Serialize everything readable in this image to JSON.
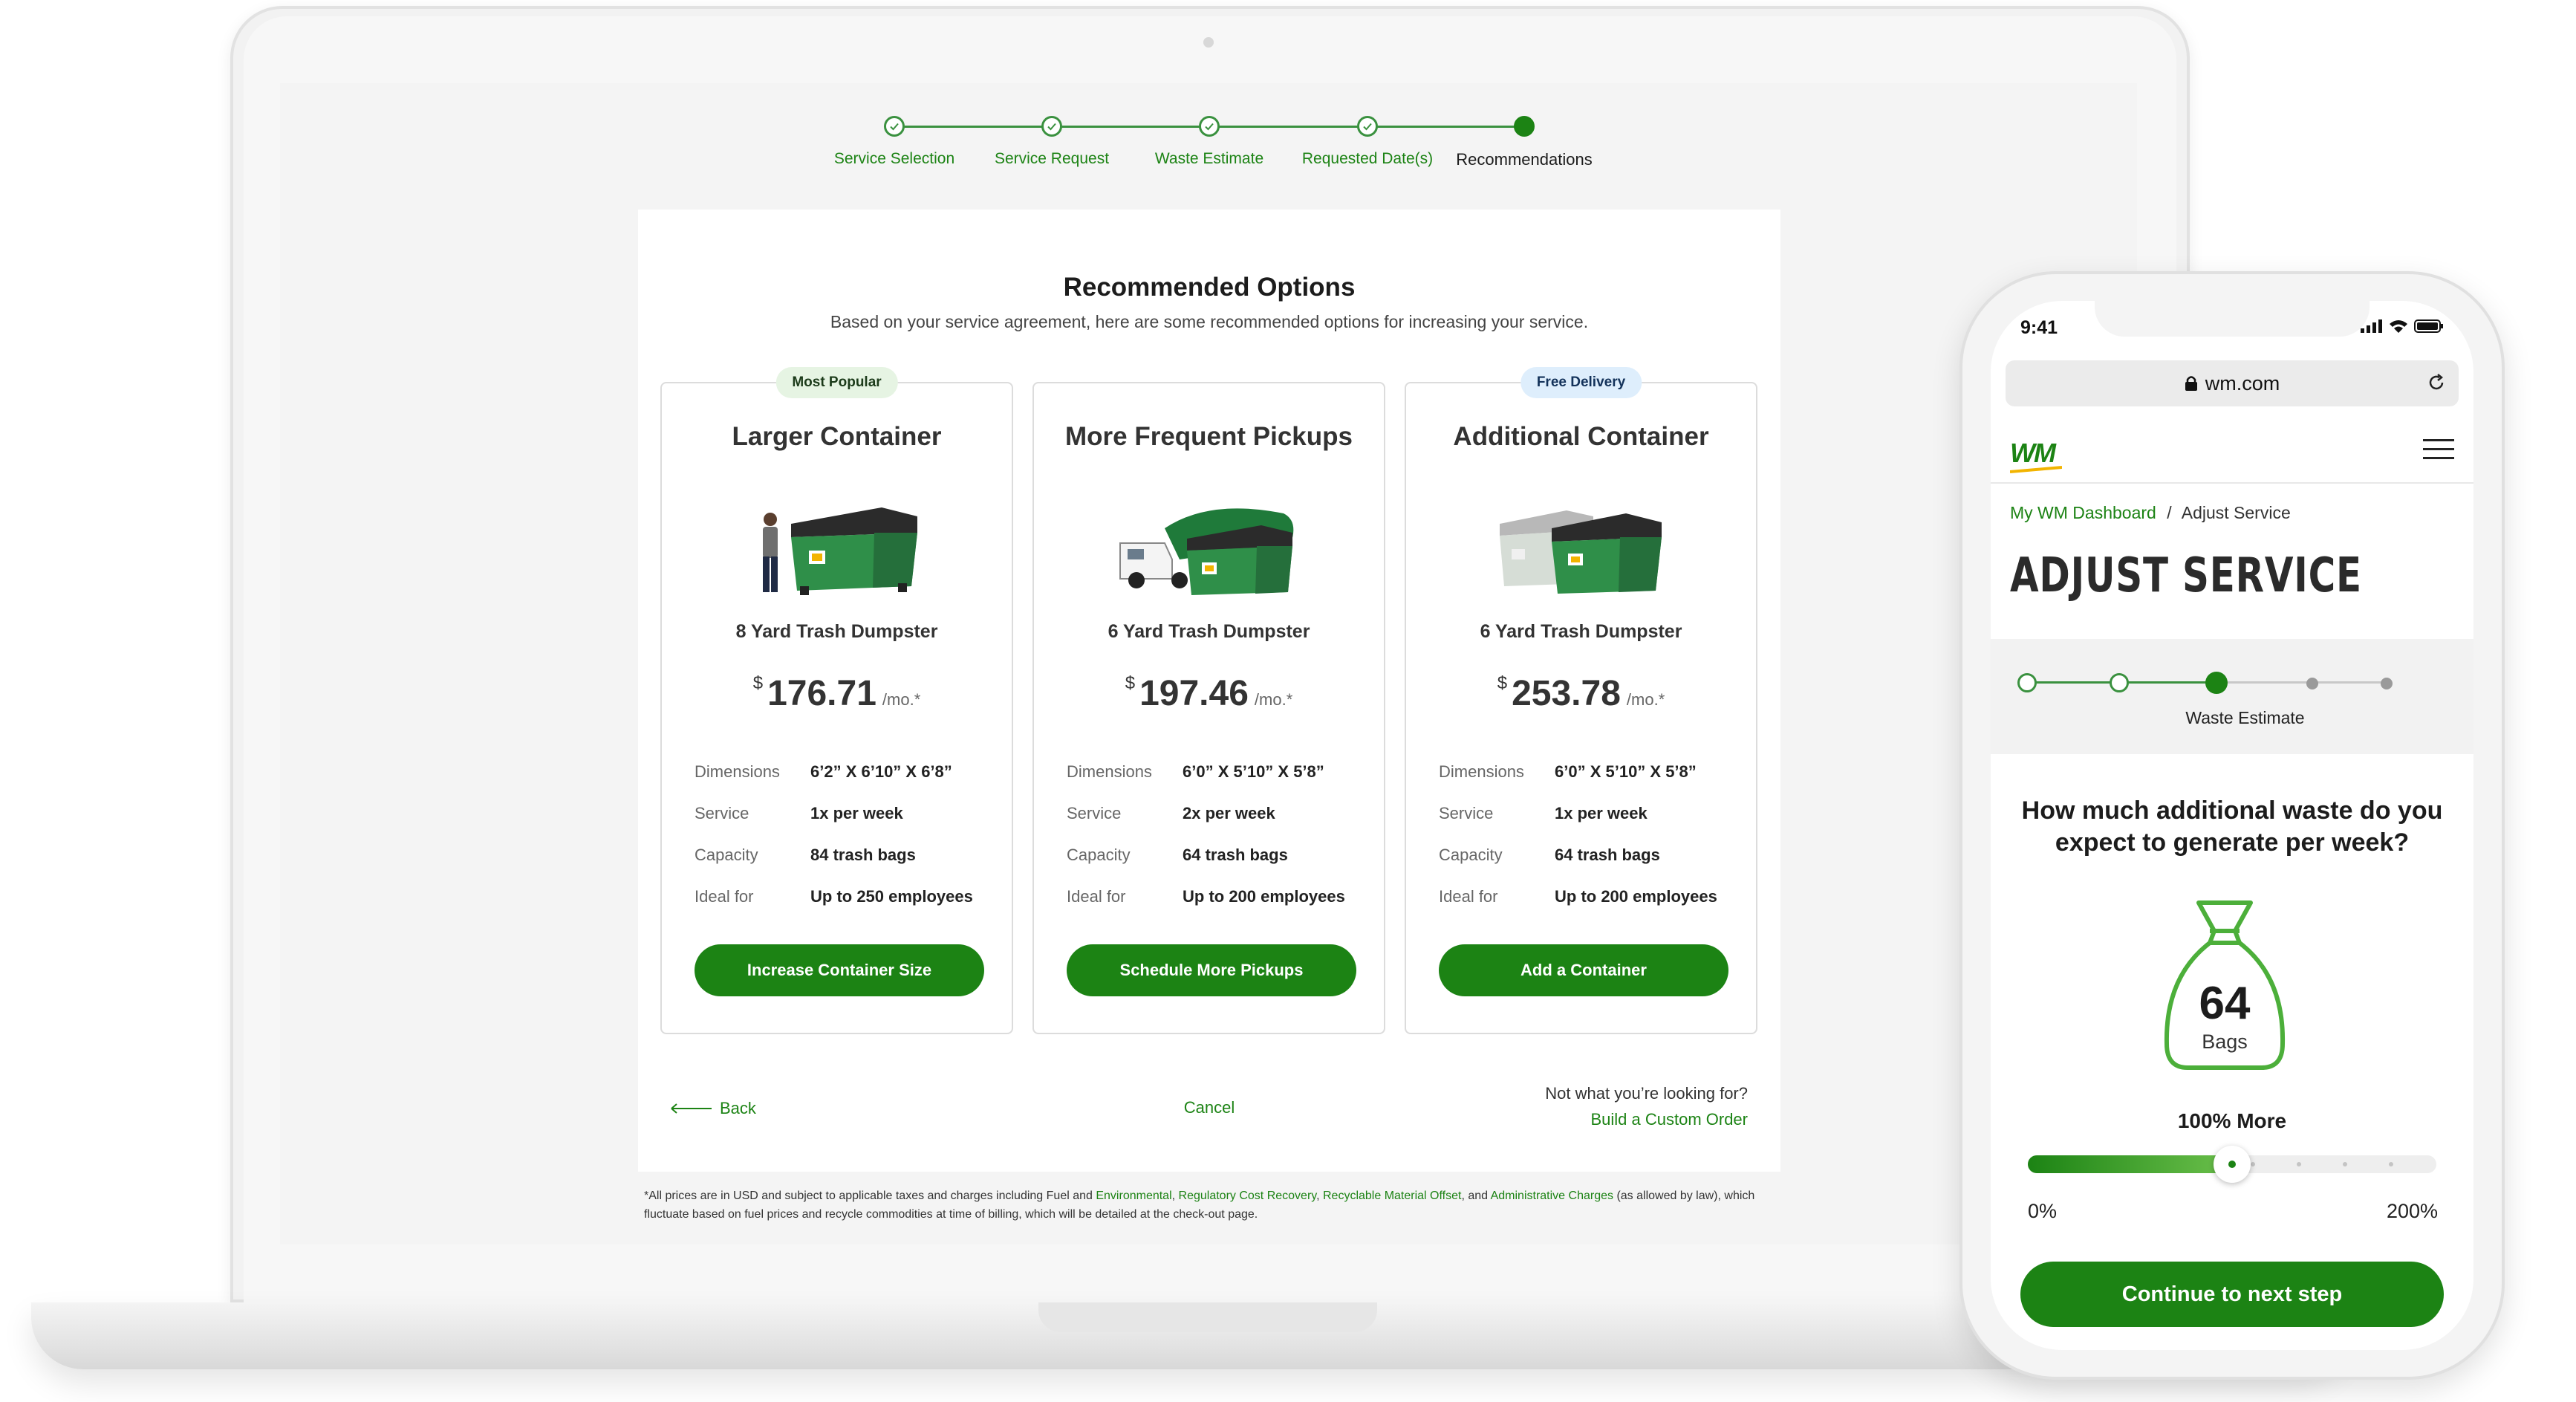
{
  "colors": {
    "brand_green": "#1c8314",
    "accent_yellow": "#f2b400",
    "light_green_badge": "#e6f4e3",
    "light_blue_badge": "#deeefc"
  },
  "desktop": {
    "stepper": {
      "steps": [
        {
          "label": "Service Selection",
          "state": "complete"
        },
        {
          "label": "Service Request",
          "state": "complete"
        },
        {
          "label": "Waste Estimate",
          "state": "complete"
        },
        {
          "label": "Requested Date(s)",
          "state": "complete"
        },
        {
          "label": "Recommendations",
          "state": "current"
        }
      ]
    },
    "title": "Recommended Options",
    "subtitle": "Based on your service agreement, here are some recommended options for increasing your service.",
    "options": [
      {
        "badge": "Most Popular",
        "title": "Larger Container",
        "image_icon": "dumpster-with-person-icon",
        "subtitle": "8 Yard Trash Dumpster",
        "currency": "$",
        "price": "176.71",
        "per": "/mo.*",
        "specs": [
          {
            "key": "Dimensions",
            "value": "6’2” X 6’10” X 6’8”"
          },
          {
            "key": "Service",
            "value": "1x per week"
          },
          {
            "key": "Capacity",
            "value": "84 trash bags"
          },
          {
            "key": "Ideal for",
            "value": "Up to 250 employees"
          }
        ],
        "button": "Increase Container Size"
      },
      {
        "badge": "",
        "title": "More Frequent Pickups",
        "image_icon": "dumpster-with-truck-icon",
        "subtitle": "6 Yard Trash Dumpster",
        "currency": "$",
        "price": "197.46",
        "per": "/mo.*",
        "specs": [
          {
            "key": "Dimensions",
            "value": "6’0” X 5’10” X 5’8”"
          },
          {
            "key": "Service",
            "value": "2x per week"
          },
          {
            "key": "Capacity",
            "value": "64 trash bags"
          },
          {
            "key": "Ideal for",
            "value": "Up to 200 employees"
          }
        ],
        "button": "Schedule More Pickups"
      },
      {
        "badge": "Free Delivery",
        "title": "Additional Container",
        "image_icon": "two-dumpsters-icon",
        "subtitle": "6 Yard Trash Dumpster",
        "currency": "$",
        "price": "253.78",
        "per": "/mo.*",
        "specs": [
          {
            "key": "Dimensions",
            "value": "6’0” X 5’10” X 5’8”"
          },
          {
            "key": "Service",
            "value": "1x per week"
          },
          {
            "key": "Capacity",
            "value": "64 trash bags"
          },
          {
            "key": "Ideal for",
            "value": "Up to 200 employees"
          }
        ],
        "button": "Add a Container"
      }
    ],
    "back": "Back",
    "cancel": "Cancel",
    "custom_question": "Not what you’re looking for?",
    "custom_link": "Build a Custom Order",
    "footnote": {
      "part1": "*All prices are in USD and subject to applicable taxes and charges including Fuel and ",
      "link1": "Environmental",
      "sep1": ", ",
      "link2": "Regulatory Cost Recovery",
      "sep2": ", ",
      "link3": "Recyclable Material Offset",
      "sep3": ", and ",
      "link4": "Administrative Charges",
      "part2": " (as allowed by law), which fluctuate based on fuel prices and recycle commodities at time of billing, which will be detailed at the check-out page."
    }
  },
  "mobile": {
    "time": "9:41",
    "url": "wm.com",
    "logo_text_w": "W",
    "logo_text_m": "M",
    "breadcrumb": {
      "link": "My WM Dashboard",
      "separator": "/",
      "current": "Adjust Service"
    },
    "heading": "ADJUST SERVICE",
    "stepper_current_label": "Waste Estimate",
    "question": "How much additional waste do you expect to generate per week?",
    "bag_count": "64",
    "bag_unit": "Bags",
    "percent_label": "100% More",
    "slider": {
      "min_label": "0%",
      "max_label": "200%",
      "value_fraction": 0.5
    },
    "cta": "Continue to next step"
  }
}
